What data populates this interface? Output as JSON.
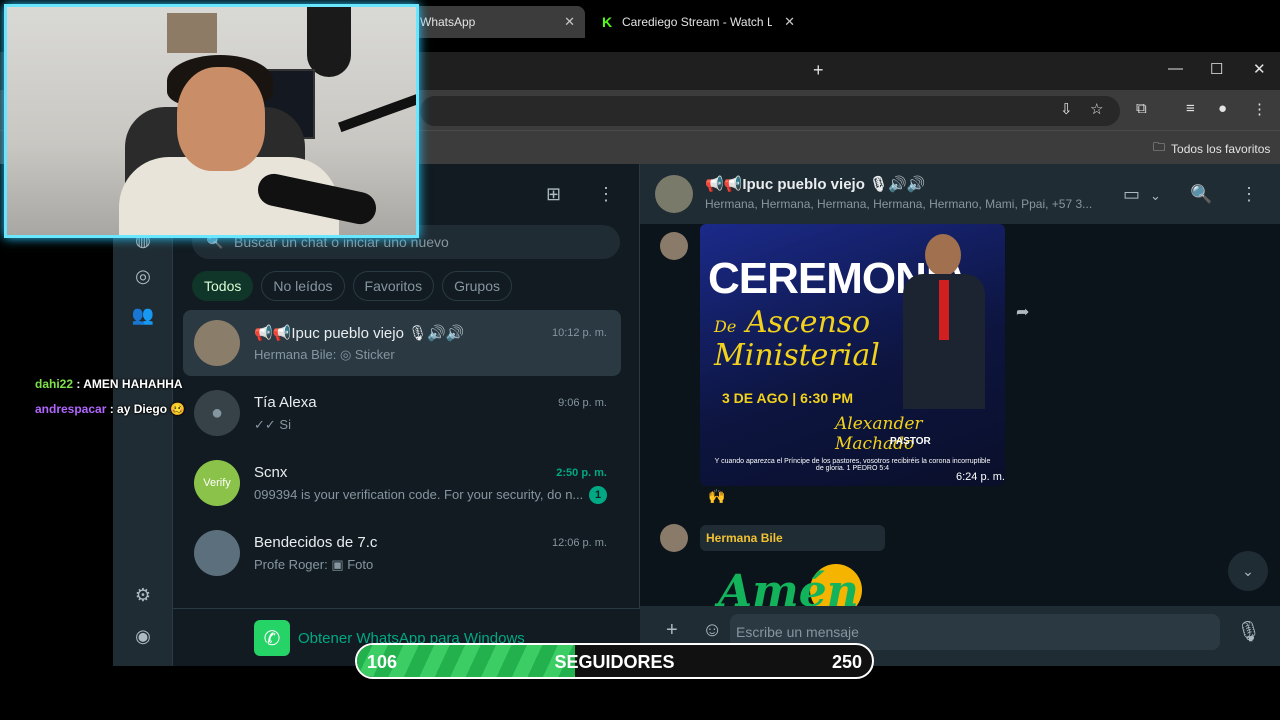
{
  "browser": {
    "tabs": [
      {
        "label": "WhatsApp",
        "active": true
      },
      {
        "label": "Carediego Stream - Watch Live",
        "active": false
      }
    ],
    "new_tab_symbol": "+",
    "window_controls": [
      "—",
      "☐",
      "✕"
    ],
    "bookmark_folder": "Todos los favoritos"
  },
  "whatsapp": {
    "search_placeholder": "Buscar un chat o iniciar uno nuevo",
    "filters": [
      "Todos",
      "No leídos",
      "Favoritos",
      "Grupos"
    ],
    "active_filter": "Todos",
    "chats": [
      {
        "name": "📢📢Ipuc pueblo viejo 🎙🔊🔊",
        "time": "10:12 p. m.",
        "last": "Hermana Bile: ◎ Sticker",
        "selected": true
      },
      {
        "name": "Tía Alexa",
        "time": "9:06 p. m.",
        "last": "✓✓ Si"
      },
      {
        "name": "Scnx",
        "time": "2:50 p. m.",
        "last": "099394 is your verification code. For your security, do n...",
        "unread": "1",
        "avatar_text": "Verify"
      },
      {
        "name": "Bendecidos de 7.c",
        "time": "12:06 p. m.",
        "last": "Profe Roger: ▣ Foto"
      }
    ],
    "promo_text": "Obtener WhatsApp para Windows",
    "conversation": {
      "title": "📢📢Ipuc pueblo viejo 🎙🔊🔊",
      "subtitle": "Hermana, Hermana, Hermana, Hermana, Hermano, Mami, Ppai, +57 3...",
      "poster": {
        "title": "CEREMONIA",
        "script_line1": "Ascenso",
        "script_prefix": "De",
        "script_line2": "Ministerial",
        "date": "3 DE AGO | 6:30 PM",
        "signature": "Alexander Machado",
        "role": "PASTOR",
        "verse": "Y cuando aparezca el Príncipe de los pastores, vosotros recibiréis la corona incorruptible de gloria. 1 PEDRO 5:4"
      },
      "poster_time": "6:24 p. m.",
      "reaction": "🙌",
      "sender": "Hermana Bile",
      "sticker_text": "Amén",
      "composer_placeholder": "Escribe un mensaje"
    }
  },
  "stream_chat": [
    {
      "user": "dahi22",
      "message": ": AMEN HAHAHHA",
      "color": "#7fe04a"
    },
    {
      "user": "andrespacar",
      "message": ": ay Diego 🥴",
      "color": "#b266ff"
    }
  ],
  "follower_goal": {
    "current": "106",
    "label": "SEGUIDORES",
    "target": "250",
    "progress": 0.424
  }
}
